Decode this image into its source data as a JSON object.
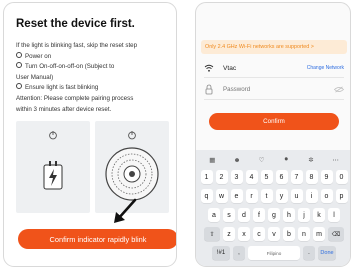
{
  "left_screen": {
    "title": "Reset the device first.",
    "instructions": {
      "intro_line1": "If the light is blinking fast, skip the reset step",
      "step1": "Power on",
      "step2_line1": "Turn On-off-on-off-on (Subject to",
      "step2_line2": "User Manual)",
      "step3": "Ensure light is fast blinking",
      "attention_line1": "Attention: Please complete pairing process",
      "attention_line2": "within 3 minutes after device reset."
    },
    "confirm_button": "Confirm indicator rapidly blink"
  },
  "right_screen": {
    "warning_banner": "Only 2.4 GHz Wi-Fi networks are supported >",
    "wifi_name": "Vtac",
    "change_network": "Change Network",
    "password_placeholder": "Password",
    "confirm_button": "Confirm",
    "keyboard": {
      "toolbar_icons": [
        "keyboard-grid-icon",
        "emoji-icon",
        "gif-icon",
        "microphone-icon",
        "settings-gear-icon",
        "more-icon"
      ],
      "rows": [
        [
          "1",
          "2",
          "3",
          "4",
          "5",
          "6",
          "7",
          "8",
          "9",
          "0"
        ],
        [
          "q",
          "w",
          "e",
          "r",
          "t",
          "y",
          "u",
          "i",
          "o",
          "p"
        ],
        [
          "a",
          "s",
          "d",
          "f",
          "g",
          "h",
          "j",
          "k",
          "l"
        ],
        [
          "z",
          "x",
          "c",
          "v",
          "b",
          "n",
          "m"
        ]
      ],
      "shift_key": "⇧",
      "backspace_key": "⌫",
      "symbols_key": "!#1",
      "comma_key": ",",
      "space_label": "Filipino",
      "period_key": ".",
      "done_key": "Done"
    }
  },
  "colors": {
    "accent": "#f0531a",
    "link": "#2f6ee0",
    "warning_text": "#f08a1e",
    "warning_bg": "#fdebd6"
  }
}
